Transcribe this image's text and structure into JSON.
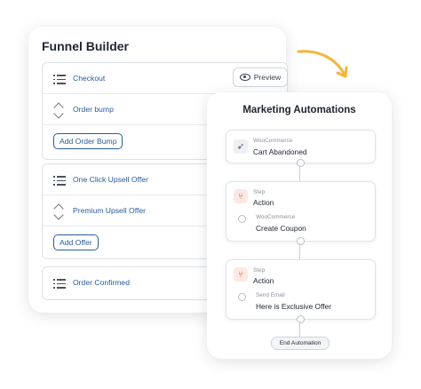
{
  "funnel_builder": {
    "title": "Funnel Builder",
    "preview_label": "Preview",
    "steps": [
      {
        "label": "Checkout",
        "icon": "list-icon"
      },
      {
        "label": "Order bump",
        "icon": "chevron-updown-icon"
      },
      {
        "label": "One Click Upsell Offer",
        "icon": "list-icon"
      },
      {
        "label": "Premium Upsell Offer",
        "icon": "chevron-updown-icon"
      },
      {
        "label": "Order Confirmed",
        "icon": "list-icon"
      }
    ],
    "add_order_bump_label": "Add Order Bump",
    "add_offer_label": "Add Offer"
  },
  "marketing_automations": {
    "title": "Marketing Automations",
    "trigger": {
      "source": "WooCommerce",
      "event": "Cart Abandoned",
      "icon": "rocket-icon"
    },
    "steps": [
      {
        "kind": "Step",
        "name": "Action",
        "sub_source": "WooCommerce",
        "sub_action": "Create Coupon",
        "icon": "branch-icon"
      },
      {
        "kind": "Step",
        "name": "Action",
        "sub_source": "Send Email",
        "sub_action": "Here is Exclusive Offer",
        "icon": "branch-icon"
      }
    ],
    "end_label": "End Automation"
  },
  "colors": {
    "link": "#2a5b9c",
    "accent_arrow": "#f2b63c",
    "action_icon": "#e05a3a"
  }
}
